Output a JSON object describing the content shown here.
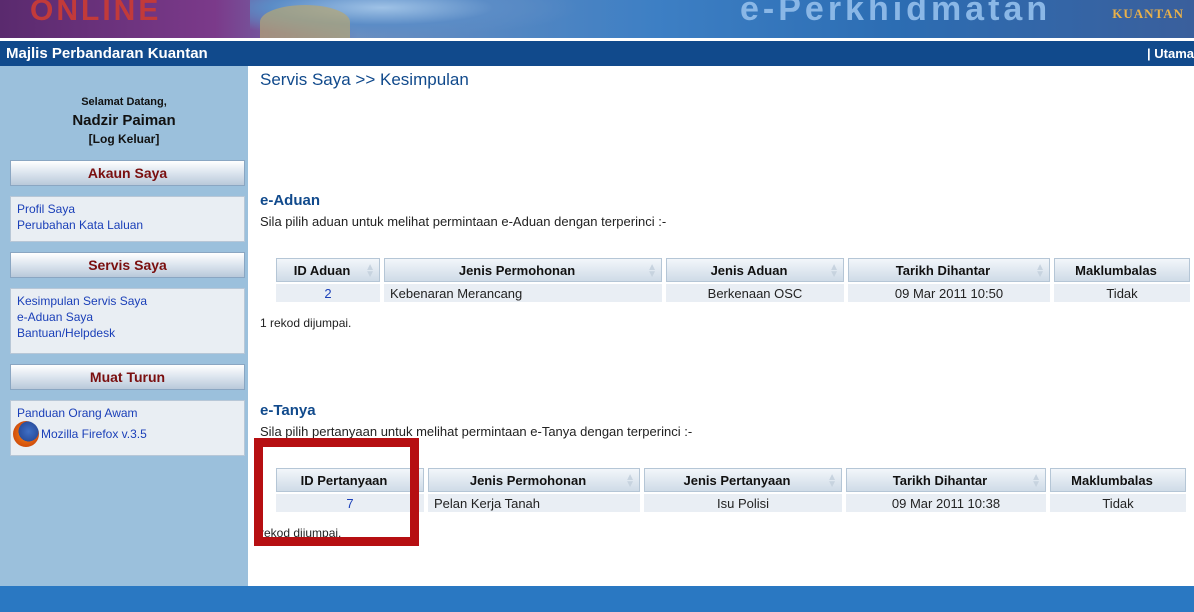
{
  "banner": {
    "left_text": "ONLINE",
    "right_text": "e-Perkhidmatan",
    "city": "KUANTAN"
  },
  "header": {
    "site_title": "Majlis Perbandaran Kuantan",
    "nav_right": "| Utama"
  },
  "sidebar": {
    "welcome_label": "Selamat Datang,",
    "user_name": "Nadzir Paiman",
    "logout": "[Log Keluar]",
    "sections": [
      {
        "title": "Akaun Saya",
        "links": [
          "Profil Saya",
          "Perubahan Kata Laluan"
        ]
      },
      {
        "title": "Servis Saya",
        "links": [
          "Kesimpulan Servis Saya",
          "e-Aduan Saya",
          "Bantuan/Helpdesk"
        ]
      },
      {
        "title": "Muat Turun",
        "links": [
          "Panduan Orang Awam",
          "Mozilla Firefox v.3.5"
        ]
      }
    ]
  },
  "main": {
    "breadcrumb": "Servis Saya >> Kesimpulan",
    "aduan": {
      "title": "e-Aduan",
      "desc": "Sila pilih aduan untuk melihat permintaan e-Aduan dengan terperinci :-",
      "columns": [
        "ID Aduan",
        "Jenis Permohonan",
        "Jenis Aduan",
        "Tarikh Dihantar",
        "Maklumbalas"
      ],
      "rows": [
        [
          "2",
          "Kebenaran Merancang",
          "Berkenaan OSC",
          "09 Mar 2011 10:50",
          "Tidak"
        ]
      ],
      "found": "1 rekod dijumpai."
    },
    "tanya": {
      "title": "e-Tanya",
      "desc": "Sila pilih pertanyaan untuk melihat permintaan e-Tanya dengan terperinci :-",
      "columns": [
        "ID Pertanyaan",
        "Jenis Permohonan",
        "Jenis Pertanyaan",
        "Tarikh Dihantar",
        "Maklumbalas"
      ],
      "rows": [
        [
          "7",
          "Pelan Kerja Tanah",
          "Isu Polisi",
          "09 Mar 2011 10:38",
          "Tidak"
        ]
      ],
      "found": "rekod dijumpai."
    }
  },
  "colors": {
    "title_bar": "#114a8c",
    "sidebar_bg": "#9bc0dc",
    "highlight": "#b60f12",
    "link": "#1a3fb8"
  }
}
